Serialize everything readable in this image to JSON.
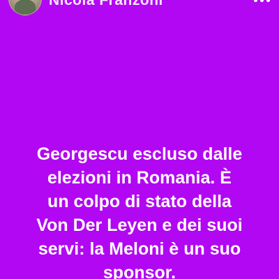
{
  "header": {
    "username": "Nicola Franzoni",
    "avatar_icon": "profile-photo",
    "more_icon": "more-options-icon"
  },
  "story": {
    "background_color": "#b207f2",
    "text_color": "#ffffff",
    "lines": [
      "Georgescu escluso dalle",
      "elezioni in Romania. È",
      "un colpo di stato della",
      "Von Der Leyen e dei suoi",
      "servi: la Meloni è un suo",
      "sponsor."
    ]
  }
}
